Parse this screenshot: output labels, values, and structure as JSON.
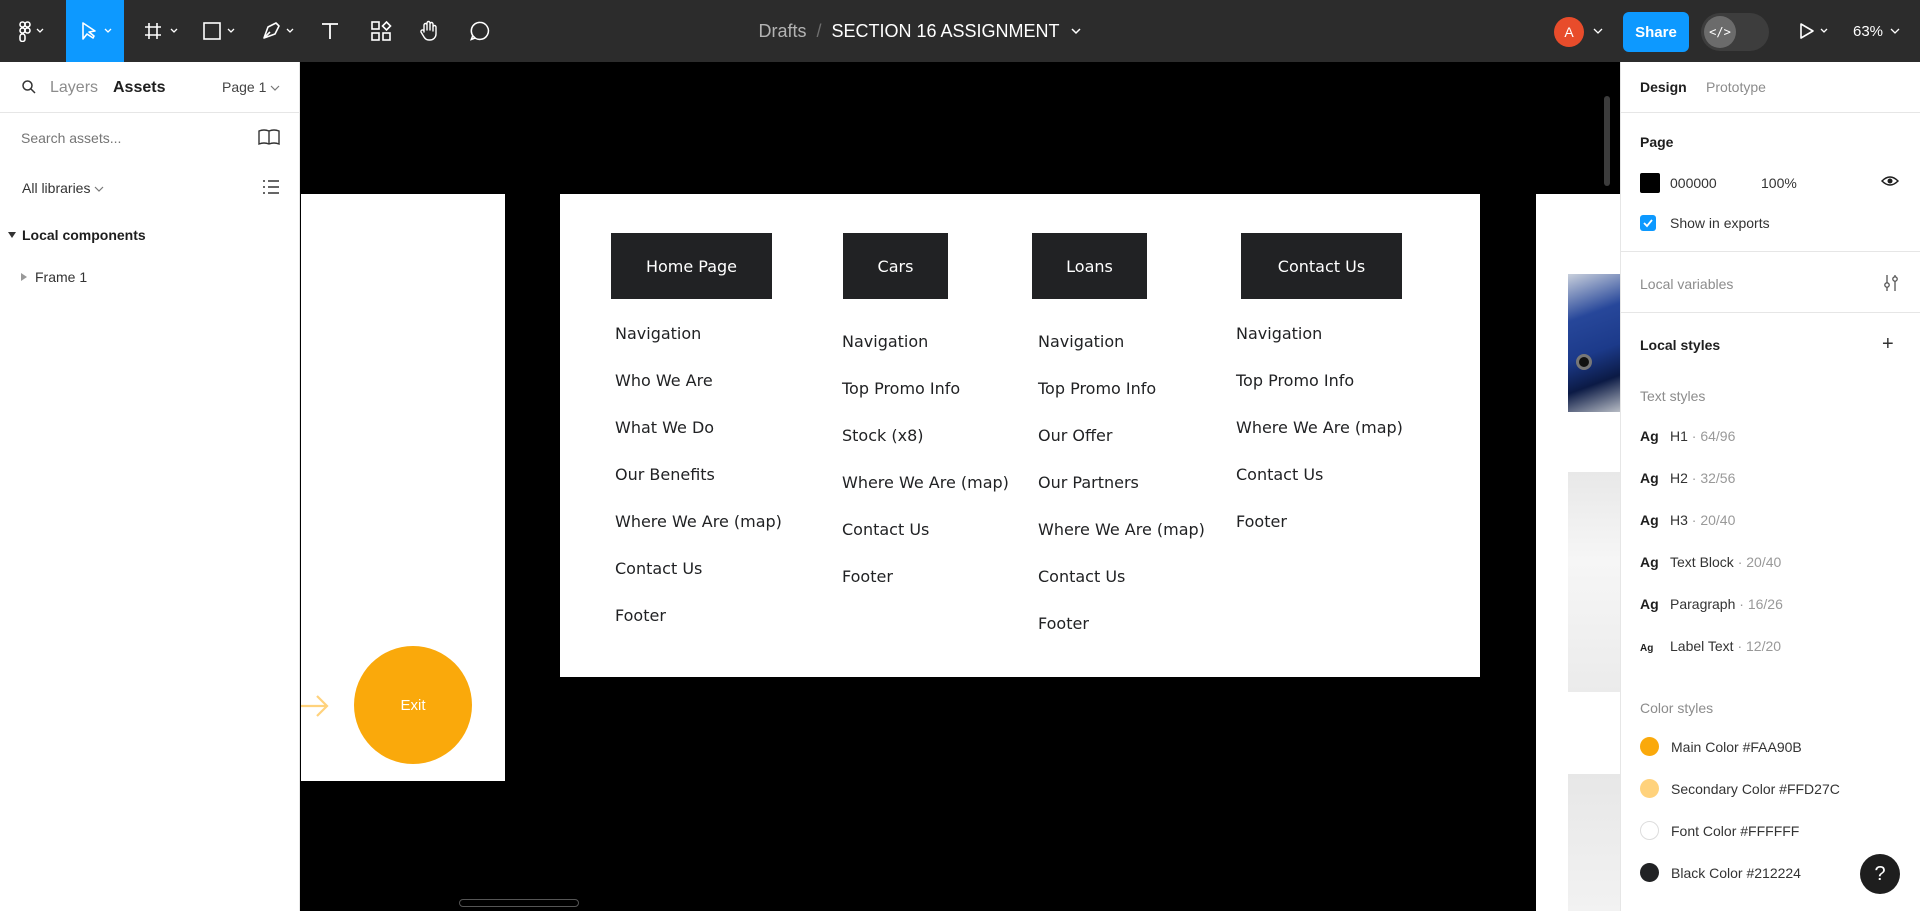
{
  "toolbar": {
    "breadcrumb_drafts": "Drafts",
    "breadcrumb_sep": "/",
    "file_title": "SECTION 16 ASSIGNMENT",
    "avatar_letter": "A",
    "share_label": "Share",
    "dev_mode_label": "</>",
    "zoom": "63%"
  },
  "left_panel": {
    "tab_layers": "Layers",
    "tab_assets": "Assets",
    "page_selector": "Page 1",
    "search_placeholder": "Search assets...",
    "libraries_label": "All libraries",
    "local_components_label": "Local components",
    "items": [
      {
        "label": "Frame 1"
      }
    ]
  },
  "canvas": {
    "exit_label": "Exit",
    "sitemap": {
      "columns": [
        {
          "heading": "Home Page",
          "items": [
            "Navigation",
            "Who We Are",
            "What We Do",
            "Our Benefits",
            "Where We Are (map)",
            "Contact Us",
            "Footer"
          ]
        },
        {
          "heading": "Cars",
          "items": [
            "Navigation",
            "Top Promo Info",
            "Stock (x8)",
            "Where We Are (map)",
            "Contact Us",
            "Footer"
          ]
        },
        {
          "heading": "Loans",
          "items": [
            "Navigation",
            "Top Promo Info",
            "Our Offer",
            "Our Partners",
            "Where We Are (map)",
            "Contact Us",
            "Footer"
          ]
        },
        {
          "heading": "Contact Us",
          "items": [
            "Navigation",
            "Top Promo Info",
            "Where We Are (map)",
            "Contact Us",
            "Footer"
          ]
        }
      ]
    }
  },
  "right_panel": {
    "tab_design": "Design",
    "tab_prototype": "Prototype",
    "page_heading": "Page",
    "page_bg_hex": "000000",
    "page_bg_opacity": "100%",
    "show_in_exports": "Show in exports",
    "local_variables": "Local variables",
    "local_styles": "Local styles",
    "text_styles_heading": "Text styles",
    "text_styles": [
      {
        "ag": "Ag",
        "name": "H1",
        "meta": "· 64/96"
      },
      {
        "ag": "Ag",
        "name": "H2",
        "meta": "· 32/56"
      },
      {
        "ag": "Ag",
        "name": "H3",
        "meta": "· 20/40"
      },
      {
        "ag": "Ag",
        "name": "Text Block",
        "meta": "· 20/40"
      },
      {
        "ag": "Ag",
        "name": "Paragraph",
        "meta": "· 16/26"
      },
      {
        "ag": "Ag",
        "name": "Label Text",
        "meta": "· 12/20"
      }
    ],
    "color_styles_heading": "Color styles",
    "color_styles": [
      {
        "label": "Main Color #FAA90B",
        "color": "#FAA90B"
      },
      {
        "label": "Secondary Color #FFD27C",
        "color": "#FFD27C"
      },
      {
        "label": "Font Color #FFFFFF",
        "color": "#FFFFFF"
      },
      {
        "label": "Black Color #212224",
        "color": "#212224"
      }
    ],
    "help_label": "?"
  },
  "icons": [
    "figma-menu-icon",
    "move-tool-icon",
    "frame-tool-icon",
    "shape-tool-icon",
    "pen-tool-icon",
    "text-tool-icon",
    "resources-icon",
    "hand-tool-icon",
    "comment-icon",
    "present-icon",
    "search-icon",
    "library-book-icon",
    "list-view-icon",
    "eye-icon",
    "variables-icon",
    "plus-icon",
    "arrow-right-icon"
  ]
}
